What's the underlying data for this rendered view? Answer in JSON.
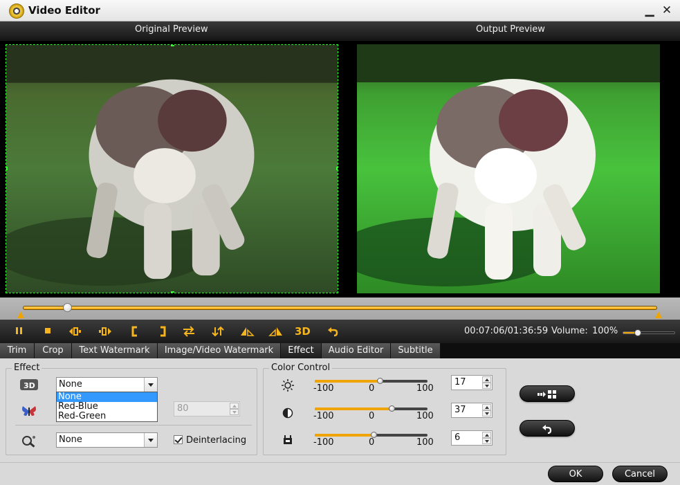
{
  "window": {
    "title": "Video Editor",
    "minimize_icon": "minimize-icon",
    "close_icon": "close-icon"
  },
  "preview": {
    "original_label": "Original Preview",
    "output_label": "Output Preview"
  },
  "playback": {
    "timecode": "00:07:06/01:36:59",
    "volume_label": "Volume:",
    "volume_value": "100%",
    "volume_level": 0.28,
    "position_fraction": 0.07,
    "buttons": [
      "pause-icon",
      "stop-icon",
      "prev-frame-icon",
      "next-frame-icon",
      "mark-in-icon",
      "mark-out-icon",
      "flip-horizontal-icon",
      "flip-vertical-icon",
      "rotate-left-icon",
      "rotate-right-icon",
      "3d-icon",
      "undo-icon"
    ],
    "three_d_label": "3D"
  },
  "tabs": [
    "Trim",
    "Crop",
    "Text Watermark",
    "Image/Video Watermark",
    "Effect",
    "Audio Editor",
    "Subtitle"
  ],
  "active_tab": "Effect",
  "effect": {
    "group_title": "Effect",
    "three_d_select": "None",
    "three_d_options": [
      "None",
      "Red-Blue",
      "Red-Green"
    ],
    "depth_value": "80",
    "filter_select": "None",
    "deinterlacing_label": "Deinterlacing",
    "deinterlacing_checked": true
  },
  "color_control": {
    "group_title": "Color Control",
    "sliders": [
      {
        "name": "brightness",
        "icon": "brightness-icon",
        "min_label": "-100",
        "mid_label": "0",
        "max_label": "100",
        "value": "17"
      },
      {
        "name": "contrast",
        "icon": "contrast-icon",
        "min_label": "-100",
        "mid_label": "0",
        "max_label": "100",
        "value": "37"
      },
      {
        "name": "saturation",
        "icon": "saturation-icon",
        "min_label": "-100",
        "mid_label": "0",
        "max_label": "100",
        "value": "6"
      }
    ]
  },
  "footer": {
    "ok_label": "OK",
    "cancel_label": "Cancel"
  },
  "colors": {
    "accent": "#f0a400",
    "select_highlight": "#3399ff",
    "crop_border": "#33ff33"
  }
}
